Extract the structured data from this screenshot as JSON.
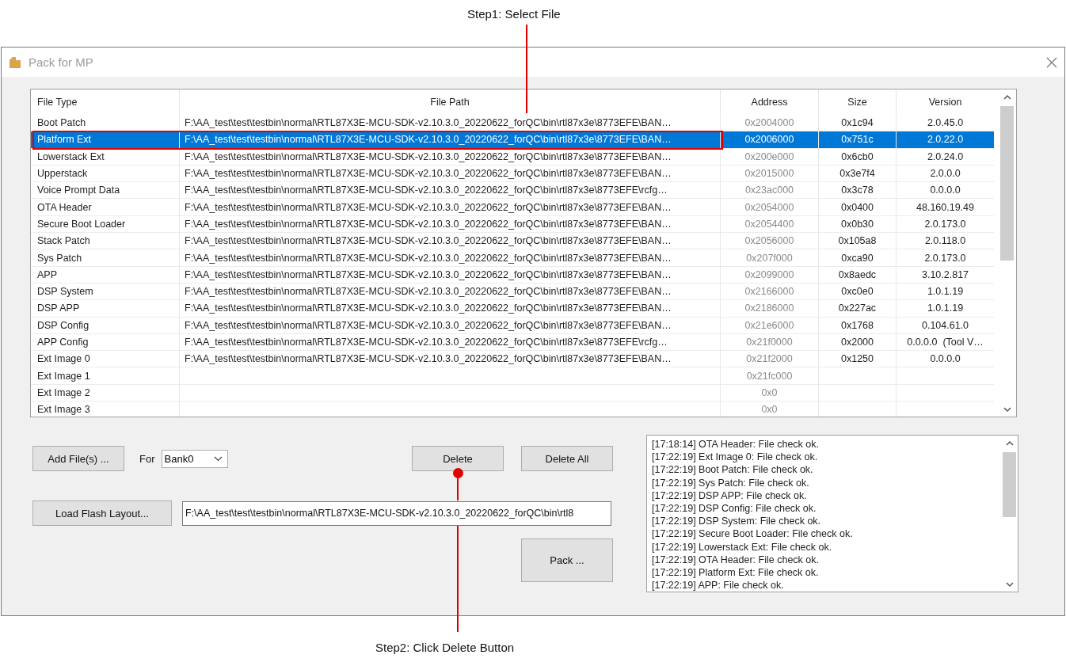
{
  "annotations": [
    {
      "kind": "top",
      "label": "Step1: Select File"
    },
    {
      "kind": "bottom",
      "label": "Step2: Click Delete Button"
    }
  ],
  "window": {
    "title": "Pack for MP"
  },
  "table": {
    "columns": [
      "File Type",
      "File Path",
      "Address",
      "Size",
      "Version"
    ],
    "rows": [
      {
        "file_type": "Boot Patch",
        "file_path": "F:\\AA_test\\test\\testbin\\normal\\RTL87X3E-MCU-SDK-v2.10.3.0_20220622_forQC\\bin\\rtl87x3e\\8773EFE\\BAN…",
        "address": "0x2004000",
        "size": "0x1c94",
        "version": "2.0.45.0",
        "selected": false
      },
      {
        "file_type": "Platform Ext",
        "file_path": "F:\\AA_test\\test\\testbin\\normal\\RTL87X3E-MCU-SDK-v2.10.3.0_20220622_forQC\\bin\\rtl87x3e\\8773EFE\\BAN…",
        "address": "0x2006000",
        "size": "0x751c",
        "version": "2.0.22.0",
        "selected": true
      },
      {
        "file_type": "Lowerstack Ext",
        "file_path": "F:\\AA_test\\test\\testbin\\normal\\RTL87X3E-MCU-SDK-v2.10.3.0_20220622_forQC\\bin\\rtl87x3e\\8773EFE\\BAN…",
        "address": "0x200e000",
        "size": "0x6cb0",
        "version": "2.0.24.0",
        "selected": false
      },
      {
        "file_type": "Upperstack",
        "file_path": "F:\\AA_test\\test\\testbin\\normal\\RTL87X3E-MCU-SDK-v2.10.3.0_20220622_forQC\\bin\\rtl87x3e\\8773EFE\\BAN…",
        "address": "0x2015000",
        "size": "0x3e7f4",
        "version": "2.0.0.0",
        "selected": false
      },
      {
        "file_type": "Voice Prompt Data",
        "file_path": "F:\\AA_test\\test\\testbin\\normal\\RTL87X3E-MCU-SDK-v2.10.3.0_20220622_forQC\\bin\\rtl87x3e\\8773EFE\\rcfg…",
        "address": "0x23ac000",
        "size": "0x3c78",
        "version": "0.0.0.0",
        "selected": false
      },
      {
        "file_type": "OTA Header",
        "file_path": "F:\\AA_test\\test\\testbin\\normal\\RTL87X3E-MCU-SDK-v2.10.3.0_20220622_forQC\\bin\\rtl87x3e\\8773EFE\\BAN…",
        "address": "0x2054000",
        "size": "0x0400",
        "version": "48.160.19.49",
        "selected": false
      },
      {
        "file_type": "Secure Boot Loader",
        "file_path": "F:\\AA_test\\test\\testbin\\normal\\RTL87X3E-MCU-SDK-v2.10.3.0_20220622_forQC\\bin\\rtl87x3e\\8773EFE\\BAN…",
        "address": "0x2054400",
        "size": "0x0b30",
        "version": "2.0.173.0",
        "selected": false
      },
      {
        "file_type": "Stack Patch",
        "file_path": "F:\\AA_test\\test\\testbin\\normal\\RTL87X3E-MCU-SDK-v2.10.3.0_20220622_forQC\\bin\\rtl87x3e\\8773EFE\\BAN…",
        "address": "0x2056000",
        "size": "0x105a8",
        "version": "2.0.118.0",
        "selected": false
      },
      {
        "file_type": "Sys Patch",
        "file_path": "F:\\AA_test\\test\\testbin\\normal\\RTL87X3E-MCU-SDK-v2.10.3.0_20220622_forQC\\bin\\rtl87x3e\\8773EFE\\BAN…",
        "address": "0x207f000",
        "size": "0xca90",
        "version": "2.0.173.0",
        "selected": false
      },
      {
        "file_type": "APP",
        "file_path": "F:\\AA_test\\test\\testbin\\normal\\RTL87X3E-MCU-SDK-v2.10.3.0_20220622_forQC\\bin\\rtl87x3e\\8773EFE\\BAN…",
        "address": "0x2099000",
        "size": "0x8aedc",
        "version": "3.10.2.817",
        "selected": false
      },
      {
        "file_type": "DSP System",
        "file_path": "F:\\AA_test\\test\\testbin\\normal\\RTL87X3E-MCU-SDK-v2.10.3.0_20220622_forQC\\bin\\rtl87x3e\\8773EFE\\BAN…",
        "address": "0x2166000",
        "size": "0xc0e0",
        "version": "1.0.1.19",
        "selected": false
      },
      {
        "file_type": "DSP APP",
        "file_path": "F:\\AA_test\\test\\testbin\\normal\\RTL87X3E-MCU-SDK-v2.10.3.0_20220622_forQC\\bin\\rtl87x3e\\8773EFE\\BAN…",
        "address": "0x2186000",
        "size": "0x227ac",
        "version": "1.0.1.19",
        "selected": false
      },
      {
        "file_type": "DSP Config",
        "file_path": "F:\\AA_test\\test\\testbin\\normal\\RTL87X3E-MCU-SDK-v2.10.3.0_20220622_forQC\\bin\\rtl87x3e\\8773EFE\\BAN…",
        "address": "0x21e6000",
        "size": "0x1768",
        "version": "0.104.61.0",
        "selected": false
      },
      {
        "file_type": "APP Config",
        "file_path": "F:\\AA_test\\test\\testbin\\normal\\RTL87X3E-MCU-SDK-v2.10.3.0_20220622_forQC\\bin\\rtl87x3e\\8773EFE\\rcfg…",
        "address": "0x21f0000",
        "size": "0x2000",
        "version": "0.0.0.0  (Tool V…",
        "selected": false
      },
      {
        "file_type": "Ext Image 0",
        "file_path": "F:\\AA_test\\test\\testbin\\normal\\RTL87X3E-MCU-SDK-v2.10.3.0_20220622_forQC\\bin\\rtl87x3e\\8773EFE\\BAN…",
        "address": "0x21f2000",
        "size": "0x1250",
        "version": "0.0.0.0",
        "selected": false
      },
      {
        "file_type": "Ext Image 1",
        "address": "0x21fc000",
        "selected": false
      },
      {
        "file_type": "Ext Image 2",
        "address": "0x0",
        "selected": false
      },
      {
        "file_type": "Ext Image 3",
        "address": "0x0",
        "selected": false
      }
    ]
  },
  "add_files_button": "Add File(s) ...",
  "bank": {
    "label": "For",
    "value": "Bank0"
  },
  "delete_button": "Delete",
  "delete_all_button": "Delete All",
  "load_flash_layout_button": "Load Flash Layout...",
  "flash_layout_path": "F:\\AA_test\\test\\testbin\\normal\\RTL87X3E-MCU-SDK-v2.10.3.0_20220622_forQC\\bin\\rtl8",
  "pack_button": "Pack ...",
  "log": [
    "[17:18:14] OTA Header: File check ok.",
    "[17:22:19] Ext Image 0: File check ok.",
    "[17:22:19] Boot Patch: File check ok.",
    "[17:22:19] Sys Patch: File check ok.",
    "[17:22:19] DSP APP: File check ok.",
    "[17:22:19] DSP Config: File check ok.",
    "[17:22:19] DSP System: File check ok.",
    "[17:22:19] Secure Boot Loader: File check ok.",
    "[17:22:19] Lowerstack Ext: File check ok.",
    "[17:22:19] OTA Header: File check ok.",
    "[17:22:19] Platform Ext: File check ok.",
    "[17:22:19] APP: File check ok."
  ]
}
